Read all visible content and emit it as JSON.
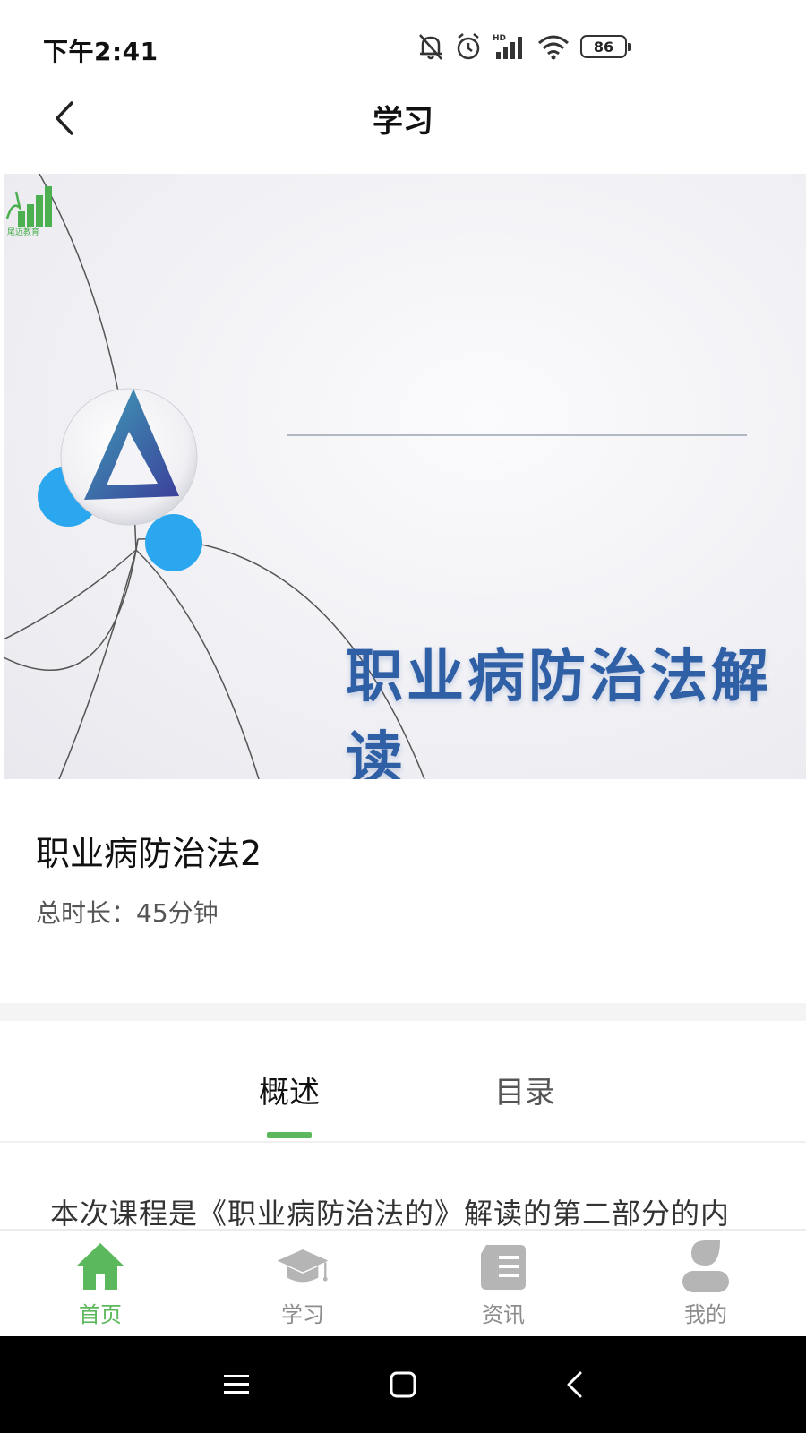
{
  "status_bar": {
    "time": "下午2:41",
    "battery": "86",
    "icons": [
      "bell-off-icon",
      "alarm-icon",
      "hd-signal-icon",
      "wifi-icon",
      "battery-icon"
    ]
  },
  "header": {
    "title": "学习",
    "back_icon": "chevron-left-icon"
  },
  "banner": {
    "title": "职业病防治法解读",
    "logo_text": "尾迈教育",
    "colors": {
      "title": "#2f5fa5",
      "accent_blue": "#2aa7ee",
      "logo_green": "#4caf50"
    }
  },
  "course": {
    "title": "职业病防治法2",
    "duration": "总时长：45分钟"
  },
  "tabs": {
    "items": [
      {
        "label": "概述",
        "active": true
      },
      {
        "label": "目录",
        "active": false
      }
    ],
    "indicator_color": "#5cb85c"
  },
  "description": {
    "text": "本次课程是《职业病防治法的》解读的第二部分的内"
  },
  "bottom_nav": {
    "items": [
      {
        "label": "首页",
        "icon": "home-icon",
        "active": true
      },
      {
        "label": "学习",
        "icon": "graduation-cap-icon",
        "active": false
      },
      {
        "label": "资讯",
        "icon": "news-icon",
        "active": false
      },
      {
        "label": "我的",
        "icon": "user-icon",
        "active": false
      }
    ],
    "active_color": "#5cb85c",
    "inactive_color": "#b5b5b5"
  },
  "system_nav": {
    "icons": [
      "menu-icon",
      "home-square-icon",
      "back-icon"
    ]
  }
}
